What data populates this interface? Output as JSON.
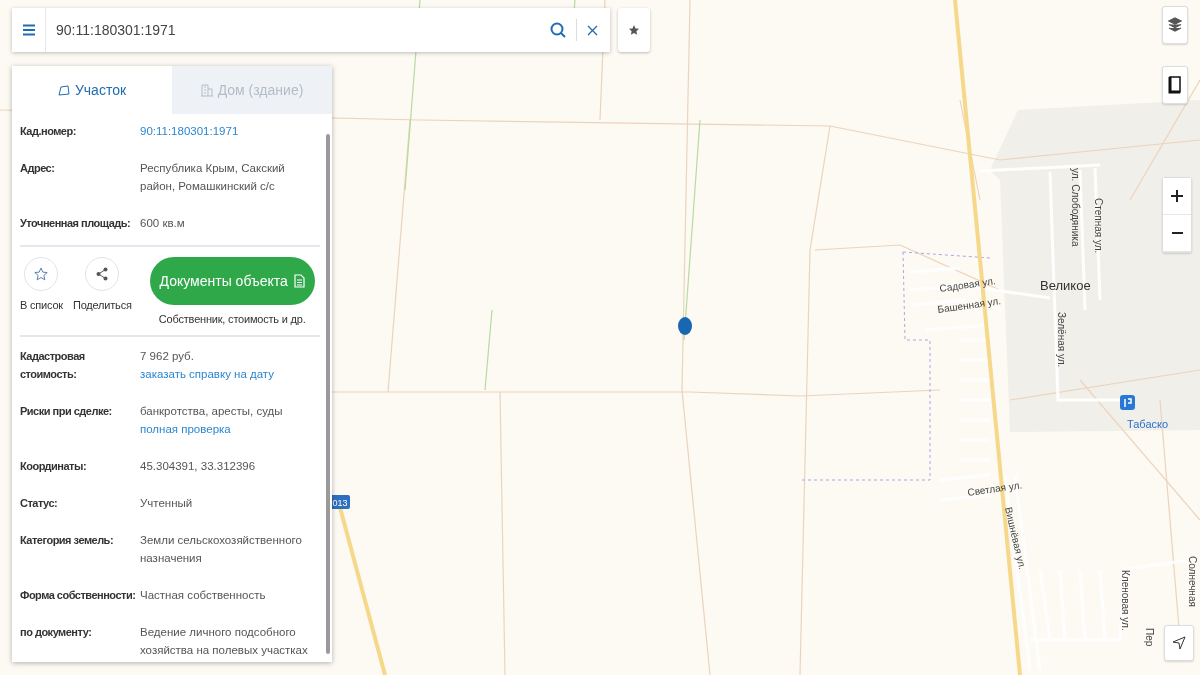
{
  "search": {
    "value": "90:11:180301:1971"
  },
  "panel": {
    "tabs": [
      {
        "label": "Участок",
        "selected": true,
        "kind": "parcel"
      },
      {
        "label": "Дом (здание)",
        "selected": false,
        "kind": "building"
      }
    ],
    "summary": [
      {
        "label": "Кад.номер:",
        "value": "90:11:180301:1971",
        "link": true
      },
      {
        "label": "Адрес:",
        "value": "Республика Крым, Сакский район, Ромашкинский с/с",
        "link": false
      },
      {
        "label": "Уточненная площадь:",
        "value": "600 кв.м",
        "link": false
      }
    ],
    "actions": [
      {
        "label": "В список",
        "kind": "star"
      },
      {
        "label": "Поделиться",
        "kind": "share"
      }
    ],
    "documents": {
      "label": "Документы объекта",
      "caption": "Собственник, стоимость и др."
    },
    "details": [
      {
        "label": "Кадастровая стоимость:",
        "value": "7 962 руб.",
        "link_text": "заказать справку на дату"
      },
      {
        "label": "Риски при сделке:",
        "value": "банкротства, аресты, суды",
        "link_text": "полная проверка"
      },
      {
        "label": "Координаты:",
        "value": "45.304391, 33.312396"
      },
      {
        "label": "Статус:",
        "value": "Учтенный"
      },
      {
        "label": "Категория земель:",
        "value": "Земли сельскохозяйственного назначения"
      },
      {
        "label": "Форма собственности:",
        "value": "Частная собственность"
      },
      {
        "label": "по документу:",
        "value": "Ведение личного подсобного хозяйства на полевых участках"
      }
    ]
  },
  "map": {
    "labels": [
      {
        "text": "Великое",
        "kind": "place"
      },
      {
        "text": "Садовая ул.",
        "kind": "street"
      },
      {
        "text": "Башенная ул.",
        "kind": "street"
      },
      {
        "text": "ул. Слободяника",
        "kind": "street"
      },
      {
        "text": "Степная ул.",
        "kind": "street"
      },
      {
        "text": "Зелёная ул.",
        "kind": "street"
      },
      {
        "text": "Светлая ул.",
        "kind": "street"
      },
      {
        "text": "Вишнёвая ул.",
        "kind": "street"
      },
      {
        "text": "Кленовая ул.",
        "kind": "street"
      },
      {
        "text": "Солнечная",
        "kind": "street"
      },
      {
        "text": "Пер",
        "kind": "street"
      },
      {
        "text": "Табаско",
        "kind": "poi"
      }
    ],
    "road_number": "013"
  }
}
